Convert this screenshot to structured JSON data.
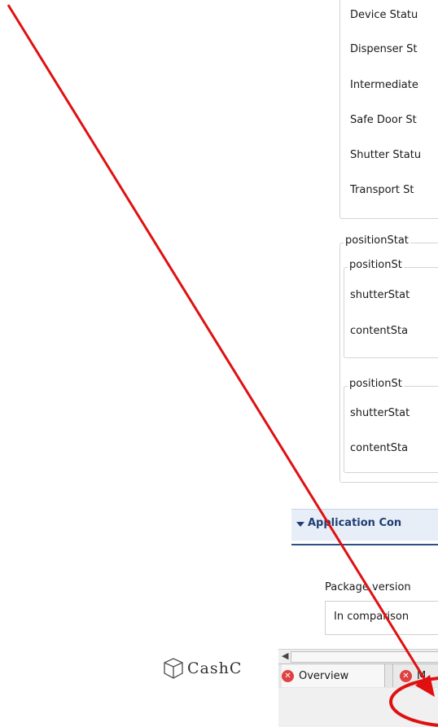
{
  "status_group": {
    "rows": [
      "Device Statu",
      "Dispenser St",
      "Intermediate",
      "Safe Door St",
      "Shutter Statu",
      "Transport St"
    ]
  },
  "position_group": {
    "legend": "positionStat",
    "subgroups": [
      {
        "legend": "positionSt",
        "rows": [
          "shutterStat",
          "contentSta"
        ]
      },
      {
        "legend": "positionSt",
        "rows": [
          "shutterStat",
          "contentSta"
        ]
      }
    ]
  },
  "application_section": {
    "title": "Application Con",
    "package_label": "Package version",
    "comparison_text": "In comparison"
  },
  "tabs": [
    {
      "label": "Overview",
      "icon": "error-icon"
    },
    {
      "label": "M",
      "icon": "error-icon"
    }
  ],
  "logo": {
    "text": "CashC"
  },
  "scrollbar": {
    "left_arrow": "◀"
  },
  "annotation": {
    "color": "#e01010"
  }
}
